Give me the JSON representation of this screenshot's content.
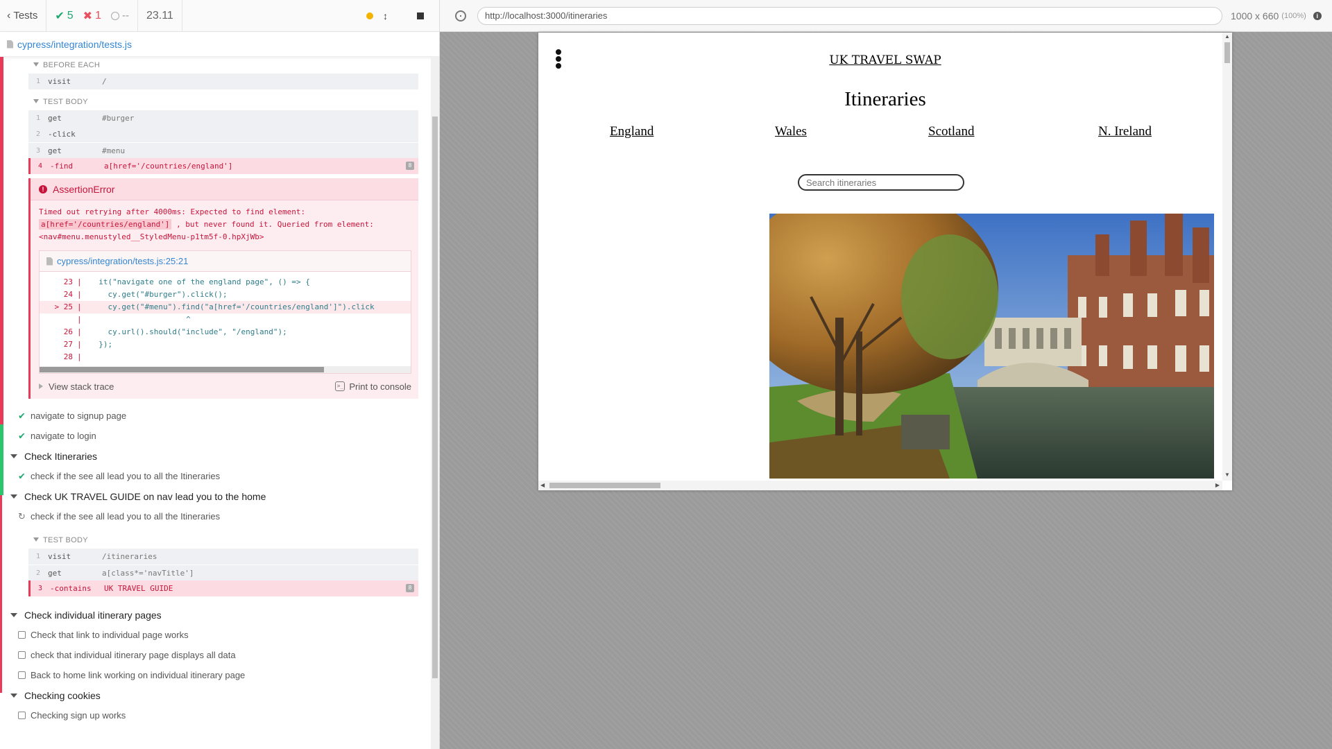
{
  "reporter": {
    "header": {
      "tests_label": "Tests",
      "passed": "5",
      "failed": "1",
      "pending": "--",
      "duration": "23.11"
    },
    "spec_file": "cypress/integration/tests.js",
    "before_each": {
      "title": "BEFORE EACH",
      "commands": [
        {
          "num": "1",
          "name": "visit",
          "msg": "/"
        }
      ]
    },
    "test_body_1": {
      "title": "TEST BODY",
      "commands": [
        {
          "num": "1",
          "name": "get",
          "msg": "#burger"
        },
        {
          "num": "2",
          "name": "-click",
          "msg": ""
        },
        {
          "num": "3",
          "name": "get",
          "msg": "#menu"
        },
        {
          "num": "4",
          "name": "-find",
          "msg": "a[href='/countries/england']",
          "badge": "8"
        }
      ]
    },
    "error": {
      "title": "AssertionError",
      "msg_part1": "Timed out retrying after 4000ms: Expected to find element:",
      "msg_code": "a[href='/countries/england']",
      "msg_part2": ", but never found it. Queried from element:",
      "msg_part3": "<nav#menu.menustyled__StyledMenu-p1tm5f-0.hpXjWb>",
      "code_location": "cypress/integration/tests.js:25:21",
      "code_lines": [
        {
          "ln": "23",
          "bar": "|",
          "code": "  it(\"navigate one of the england page\", () => {"
        },
        {
          "ln": "24",
          "bar": "|",
          "code": "    cy.get(\"#burger\").click();"
        },
        {
          "ln": "> 25",
          "bar": "|",
          "code": "    cy.get(\"#menu\").find(\"a[href='/countries/england']\").click"
        },
        {
          "ln": "",
          "bar": "|",
          "code": "                     ^"
        },
        {
          "ln": "26",
          "bar": "|",
          "code": "    cy.url().should(\"include\", \"/england\");"
        },
        {
          "ln": "27",
          "bar": "|",
          "code": "  });"
        },
        {
          "ln": "28",
          "bar": "|",
          "code": ""
        }
      ],
      "view_stack": "View stack trace",
      "print_console": "Print to console"
    },
    "tests_a": [
      {
        "status": "passed",
        "label": "navigate to signup page"
      },
      {
        "status": "passed",
        "label": "navigate to login"
      }
    ],
    "suite_itineraries": "Check Itineraries",
    "test_itin": {
      "status": "passed",
      "label": "check if the see all lead you to all the Itineraries"
    },
    "suite_nav": "Check UK TRAVEL GUIDE on nav lead you to the home",
    "test_nav": {
      "status": "running",
      "label": "check if the see all lead you to all the Itineraries"
    },
    "test_body_2": {
      "title": "TEST BODY",
      "commands": [
        {
          "num": "1",
          "name": "visit",
          "msg": "/itineraries"
        },
        {
          "num": "2",
          "name": "get",
          "msg": "a[class*='navTitle']"
        },
        {
          "num": "3",
          "name": "-contains",
          "msg": "UK TRAVEL GUIDE",
          "badge": "8"
        }
      ]
    },
    "suite_individual": "Check individual itinerary pages",
    "tests_individual": [
      "Check that link to individual page works",
      "check that individual itinerary page displays all data",
      "Back to home link working on individual itinerary page"
    ],
    "suite_cookies": "Checking cookies",
    "tests_cookies": [
      "Checking sign up works"
    ]
  },
  "browser": {
    "url": "http://localhost:3000/itineraries",
    "viewport": "1000 x 660",
    "zoom": "(100%)"
  },
  "app": {
    "site_title": "UK TRAVEL SWAP",
    "heading": "Itineraries",
    "countries": [
      "England",
      "Wales",
      "Scotland",
      "N. Ireland"
    ],
    "search_placeholder": "Search itineraries"
  },
  "colors": {
    "pass": "#1fa971",
    "fail": "#e94f5f",
    "link": "#3386d4"
  }
}
